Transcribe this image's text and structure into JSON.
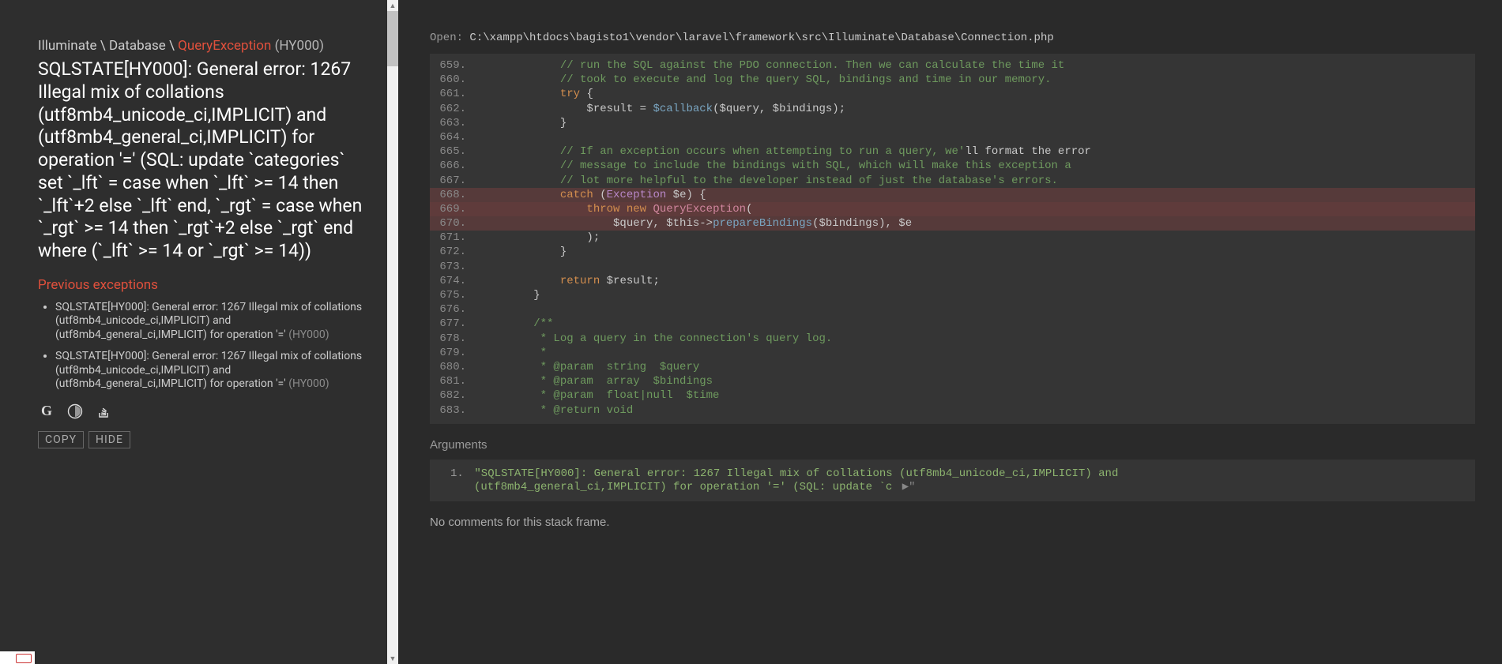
{
  "sidebar": {
    "breadcrumb": {
      "ns1": "Illuminate",
      "ns2": "Database",
      "exc": "QueryException",
      "code": "(HY000)"
    },
    "main_message": "SQLSTATE[HY000]: General error: 1267 Illegal mix of collations (utf8mb4_unicode_ci,IMPLICIT) and (utf8mb4_general_ci,IMPLICIT) for operation '=' (SQL: update `categories` set `_lft` = case when `_lft` >= 14 then `_lft`+2 else `_lft` end, `_rgt` = case when `_rgt` >= 14 then `_rgt`+2 else `_rgt` end where (`_lft` >= 14 or `_rgt` >= 14))",
    "prev_heading": "Previous exceptions",
    "prev": [
      {
        "msg": "SQLSTATE[HY000]: General error: 1267 Illegal mix of collations (utf8mb4_unicode_ci,IMPLICIT) and (utf8mb4_general_ci,IMPLICIT) for operation '='",
        "code": "(HY000)"
      },
      {
        "msg": "SQLSTATE[HY000]: General error: 1267 Illegal mix of collations (utf8mb4_unicode_ci,IMPLICIT) and (utf8mb4_general_ci,IMPLICIT) for operation '='",
        "code": "(HY000)"
      }
    ],
    "icons": {
      "google": "G",
      "duck": "◐",
      "stack": "≣"
    },
    "buttons": {
      "copy": "COPY",
      "hide": "HIDE"
    }
  },
  "main": {
    "open_label": "Open:",
    "file_path": "C:\\xampp\\htdocs\\bagisto1\\vendor\\laravel\\framework\\src\\Illuminate\\Database\\Connection.php",
    "code": [
      {
        "n": "659.",
        "kind": "c",
        "html": "            <span class='tok-cm'>// run the SQL against the PDO connection. Then we can calculate the time it</span>"
      },
      {
        "n": "660.",
        "kind": "c",
        "html": "            <span class='tok-cm'>// took to execute and log the query SQL, bindings and time in our memory.</span>"
      },
      {
        "n": "661.",
        "kind": "",
        "html": "            <span class='tok-kw'>try</span> {"
      },
      {
        "n": "662.",
        "kind": "",
        "html": "                $result = <span class='tok-fn'>$callback</span>($query, $bindings);"
      },
      {
        "n": "663.",
        "kind": "",
        "html": "            }"
      },
      {
        "n": "664.",
        "kind": "",
        "html": ""
      },
      {
        "n": "665.",
        "kind": "c",
        "html": "            <span class='tok-cm'>// If an exception occurs when attempting to run a query, we'</span>ll format the error"
      },
      {
        "n": "666.",
        "kind": "c",
        "html": "            <span class='tok-cm'>// message to include the bindings with SQL, which will make this exception a</span>"
      },
      {
        "n": "667.",
        "kind": "c",
        "html": "            <span class='tok-cm'>// lot more helpful to the developer instead of just the database's errors.</span>"
      },
      {
        "n": "668.",
        "kind": "hl",
        "html": "            <span class='tok-kw'>catch</span> (<span class='tok-cls'>Exception</span> $e) {"
      },
      {
        "n": "669.",
        "kind": "hlmain",
        "html": "                <span class='tok-kw'>throw</span> <span class='tok-kw'>new</span> <span class='tok-ex'>QueryException</span>("
      },
      {
        "n": "670.",
        "kind": "hl",
        "html": "                    $query, $this-><span class='tok-fn'>prepareBindings</span>($bindings), $e"
      },
      {
        "n": "671.",
        "kind": "",
        "html": "                );"
      },
      {
        "n": "672.",
        "kind": "",
        "html": "            }"
      },
      {
        "n": "673.",
        "kind": "",
        "html": ""
      },
      {
        "n": "674.",
        "kind": "",
        "html": "            <span class='tok-kw'>return</span> $result;"
      },
      {
        "n": "675.",
        "kind": "",
        "html": "        }"
      },
      {
        "n": "676.",
        "kind": "",
        "html": ""
      },
      {
        "n": "677.",
        "kind": "d",
        "html": "        <span class='tok-doc'>/**</span>"
      },
      {
        "n": "678.",
        "kind": "d",
        "html": "        <span class='tok-doc'> * Log a query in the connection's query log.</span>"
      },
      {
        "n": "679.",
        "kind": "d",
        "html": "        <span class='tok-doc'> *</span>"
      },
      {
        "n": "680.",
        "kind": "d",
        "html": "        <span class='tok-doc'> * @param  string  $query</span>"
      },
      {
        "n": "681.",
        "kind": "d",
        "html": "        <span class='tok-doc'> * @param  array  $bindings</span>"
      },
      {
        "n": "682.",
        "kind": "d",
        "html": "        <span class='tok-doc'> * @param  float|null  $time</span>"
      },
      {
        "n": "683.",
        "kind": "d",
        "html": "        <span class='tok-doc'> * @return void</span>"
      }
    ],
    "args_heading": "Arguments",
    "argument": {
      "index": "1.",
      "line1": "\"SQLSTATE[HY000]: General error: 1267 Illegal mix of collations (utf8mb4_unicode_ci,IMPLICIT) and",
      "line2": "(utf8mb4_general_ci,IMPLICIT) for operation '=' (SQL: update `c",
      "more": " ▶\""
    },
    "no_comments": "No comments for this stack frame."
  }
}
